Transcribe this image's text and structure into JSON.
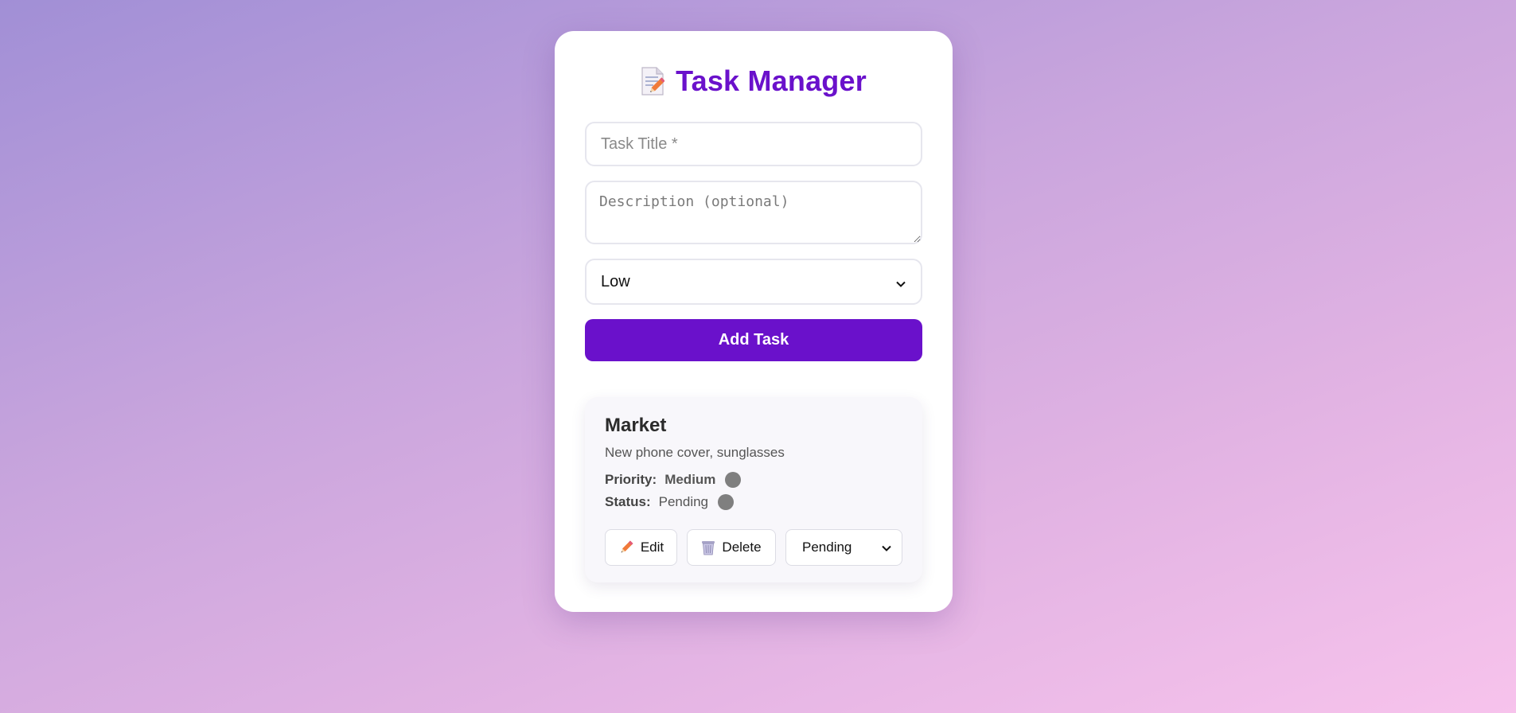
{
  "app": {
    "title": "Task Manager",
    "title_icon": "memo-icon",
    "accent_color": "#6a11cb"
  },
  "form": {
    "title_placeholder": "Task Title *",
    "title_value": "",
    "description_placeholder": "Description (optional)",
    "description_value": "",
    "priority_selected": "Low",
    "submit_label": "Add Task"
  },
  "tasks": [
    {
      "title": "Market",
      "description": "New phone cover, sunglasses",
      "priority_label": "Priority:",
      "priority_value": "Medium",
      "priority_dot_color": "#7f7f7f",
      "status_label": "Status:",
      "status_value": "Pending",
      "status_dot_color": "#7f7f7f",
      "edit_label": "Edit",
      "edit_icon": "pencil-icon",
      "delete_label": "Delete",
      "delete_icon": "wastebasket-icon",
      "status_select_value": "Pending"
    }
  ]
}
